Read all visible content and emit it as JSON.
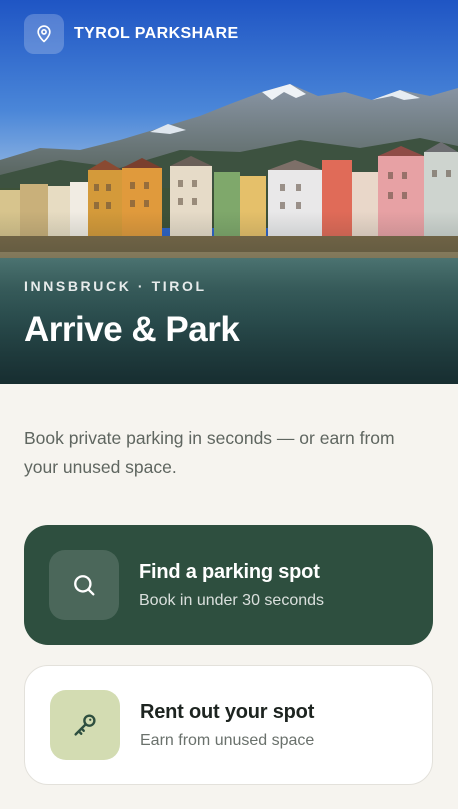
{
  "brand": {
    "name": "TYROL PARKSHARE",
    "icon": "map-pin-icon"
  },
  "hero": {
    "eyebrow": "INNSBRUCK · TIROL",
    "title": "Arrive & Park"
  },
  "intro": {
    "text": "Book private parking in seconds — or earn from your unused space."
  },
  "actions": {
    "find": {
      "title": "Find a parking spot",
      "subtitle": "Book in under 30 seconds",
      "icon": "search-icon"
    },
    "rent": {
      "title": "Rent out your spot",
      "subtitle": "Earn from unused space",
      "icon": "key-icon"
    }
  },
  "colors": {
    "primary": "#2e4f3f",
    "accent_soft": "#d3dcb2",
    "background": "#f6f4ef"
  }
}
